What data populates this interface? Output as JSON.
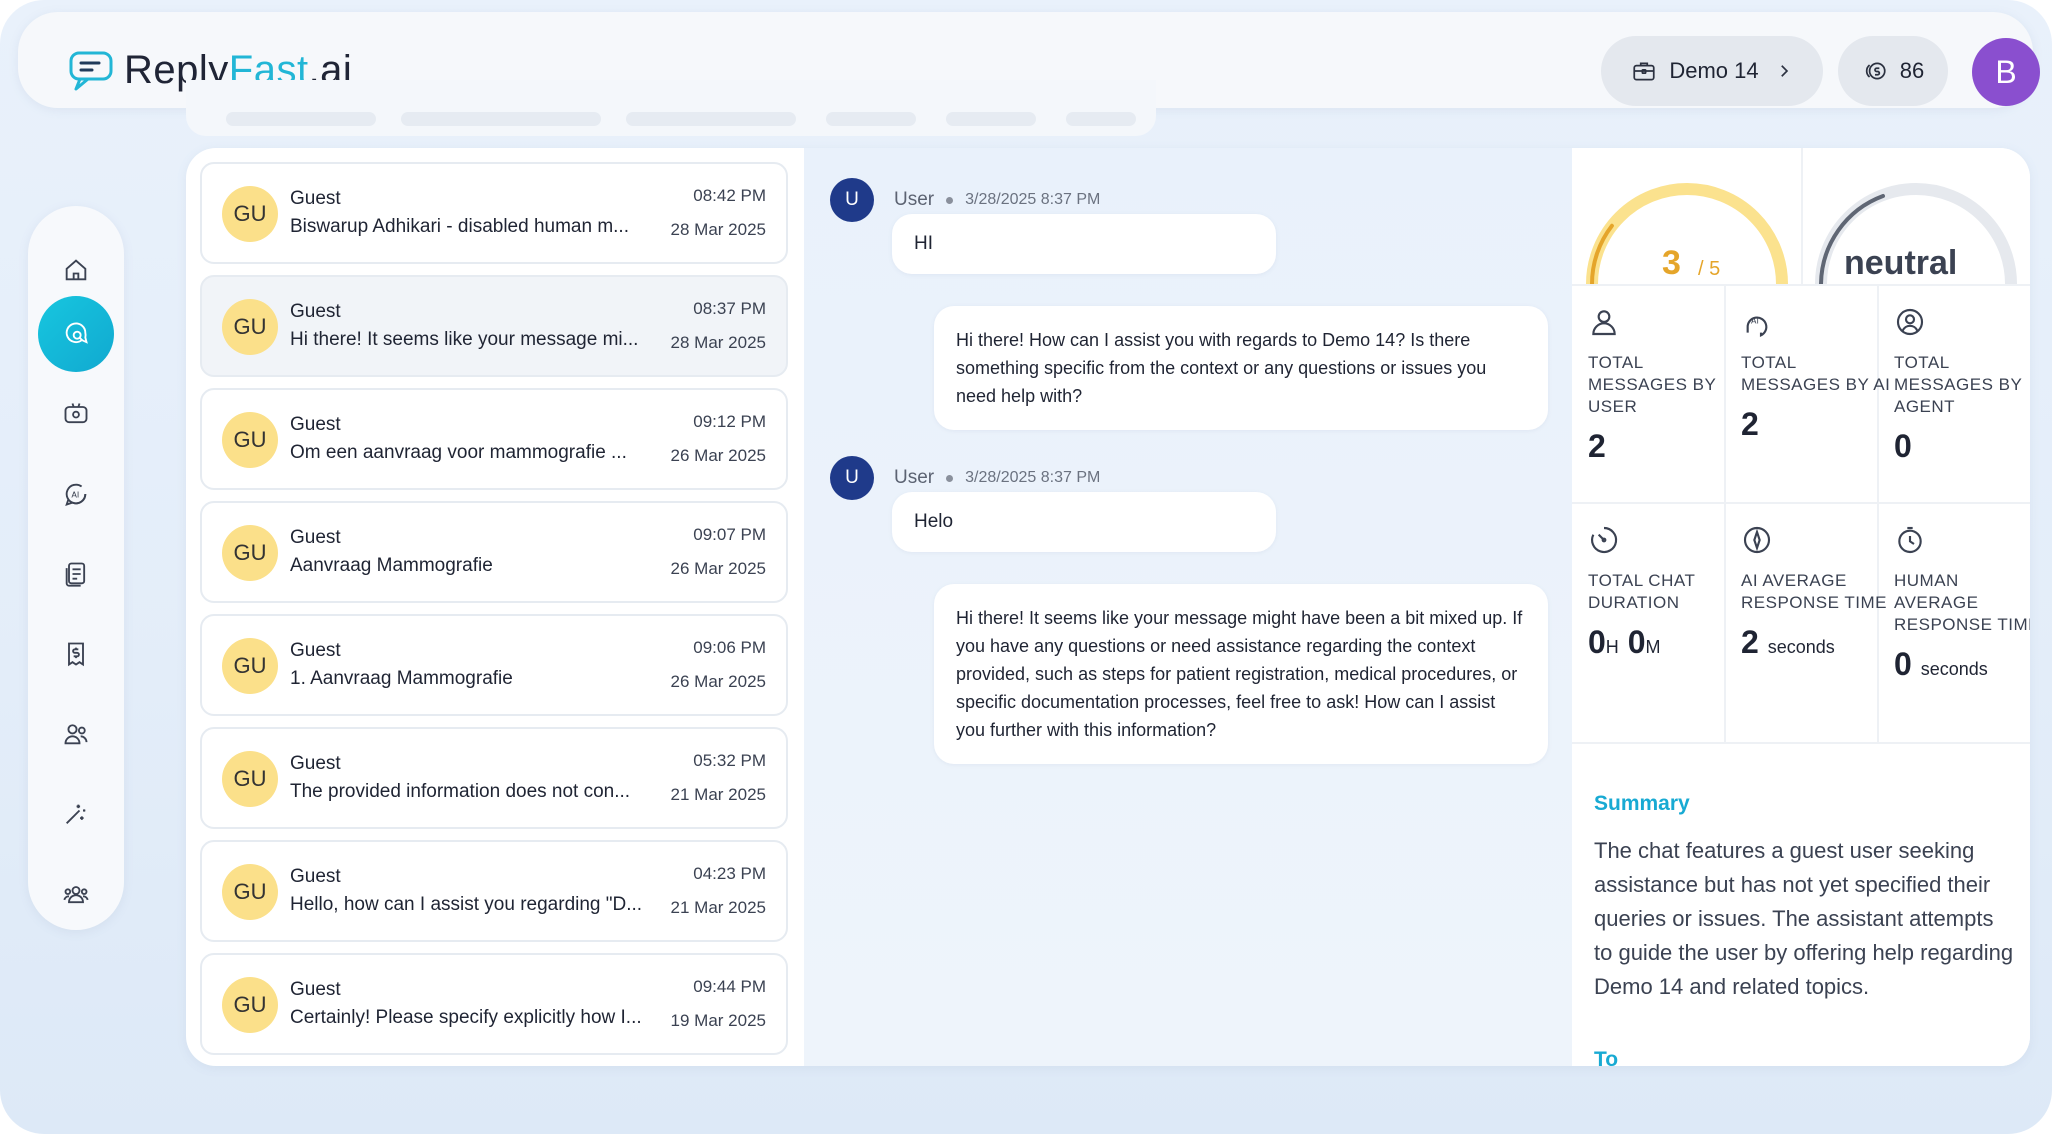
{
  "brand": {
    "part1": "Reply",
    "part2": "Fast",
    "part3": ".ai"
  },
  "header": {
    "project": "Demo 14",
    "credits": "86",
    "avatar_initial": "B"
  },
  "conversations": [
    {
      "initials": "GU",
      "name": "Guest",
      "snippet": "Biswarup Adhikari - disabled human m...",
      "time": "08:42 PM",
      "date": "28 Mar 2025"
    },
    {
      "initials": "GU",
      "name": "Guest",
      "snippet": "Hi there! It seems like your message mi...",
      "time": "08:37 PM",
      "date": "28 Mar 2025"
    },
    {
      "initials": "GU",
      "name": "Guest",
      "snippet": "Om een aanvraag voor mammografie ...",
      "time": "09:12 PM",
      "date": "26 Mar 2025"
    },
    {
      "initials": "GU",
      "name": "Guest",
      "snippet": "Aanvraag Mammografie",
      "time": "09:07 PM",
      "date": "26 Mar 2025"
    },
    {
      "initials": "GU",
      "name": "Guest",
      "snippet": "1. Aanvraag Mammografie",
      "time": "09:06 PM",
      "date": "26 Mar 2025"
    },
    {
      "initials": "GU",
      "name": "Guest",
      "snippet": "The provided information does not con...",
      "time": "05:32 PM",
      "date": "21 Mar 2025"
    },
    {
      "initials": "GU",
      "name": "Guest",
      "snippet": "Hello, how can I assist you regarding \"D...",
      "time": "04:23 PM",
      "date": "21 Mar 2025"
    },
    {
      "initials": "GU",
      "name": "Guest",
      "snippet": "Certainly! Please specify explicitly how I...",
      "time": "09:44 PM",
      "date": "19 Mar 2025"
    }
  ],
  "chat": {
    "messages": [
      {
        "avatar": "U",
        "sender": "User",
        "timestamp": "3/28/2025 8:37 PM",
        "text": "HI"
      },
      {
        "text": "Hi there! How can I assist you with regards to Demo 14? Is there something specific from the context or any questions or issues you need help with?"
      },
      {
        "avatar": "U",
        "sender": "User",
        "timestamp": "3/28/2025 8:37 PM",
        "text": "Helo"
      },
      {
        "text": "Hi there! It seems like your message might have been a bit mixed up. If you have any questions or need assistance regarding the context provided, such as steps for patient registration, medical procedures, or specific documentation processes, feel free to ask! How can I assist you further with this information?"
      }
    ]
  },
  "insights": {
    "rating": {
      "value": "3",
      "denominator": "/ 5",
      "fraction": 0.6
    },
    "sentiment": "neutral",
    "stats": [
      {
        "label": "TOTAL MESSAGES BY USER",
        "value": "2",
        "icon": "user-icon"
      },
      {
        "label": "TOTAL MESSAGES BY AI",
        "value": "2",
        "icon": "ai-head-icon"
      },
      {
        "label": "TOTAL MESSAGES BY AGENT",
        "value": "0",
        "icon": "agent-icon"
      },
      {
        "label": "TOTAL CHAT DURATION",
        "hours": "0",
        "hours_unit": "H",
        "minutes": "0",
        "minutes_unit": "M",
        "icon": "duration-icon"
      },
      {
        "label": "AI AVERAGE RESPONSE TIME",
        "value": "2",
        "unit": "seconds",
        "icon": "compass-icon"
      },
      {
        "label": "HUMAN AVERAGE RESPONSE TIME",
        "value": "0",
        "unit": "seconds",
        "icon": "stopwatch-icon"
      }
    ],
    "summary_title": "Summary",
    "summary_text": "The chat features a guest user seeking assistance but has not yet specified their queries or issues. The assistant attempts to guide the user by offering help regarding Demo 14 and related topics.",
    "next_section_peek": "To"
  },
  "colors": {
    "accent": "#18aad3",
    "rating": "#e5a52a",
    "user_avatar": "#1f3a8a",
    "guest_avatar": "#fbe08a",
    "profile": "#8a4fcf"
  }
}
